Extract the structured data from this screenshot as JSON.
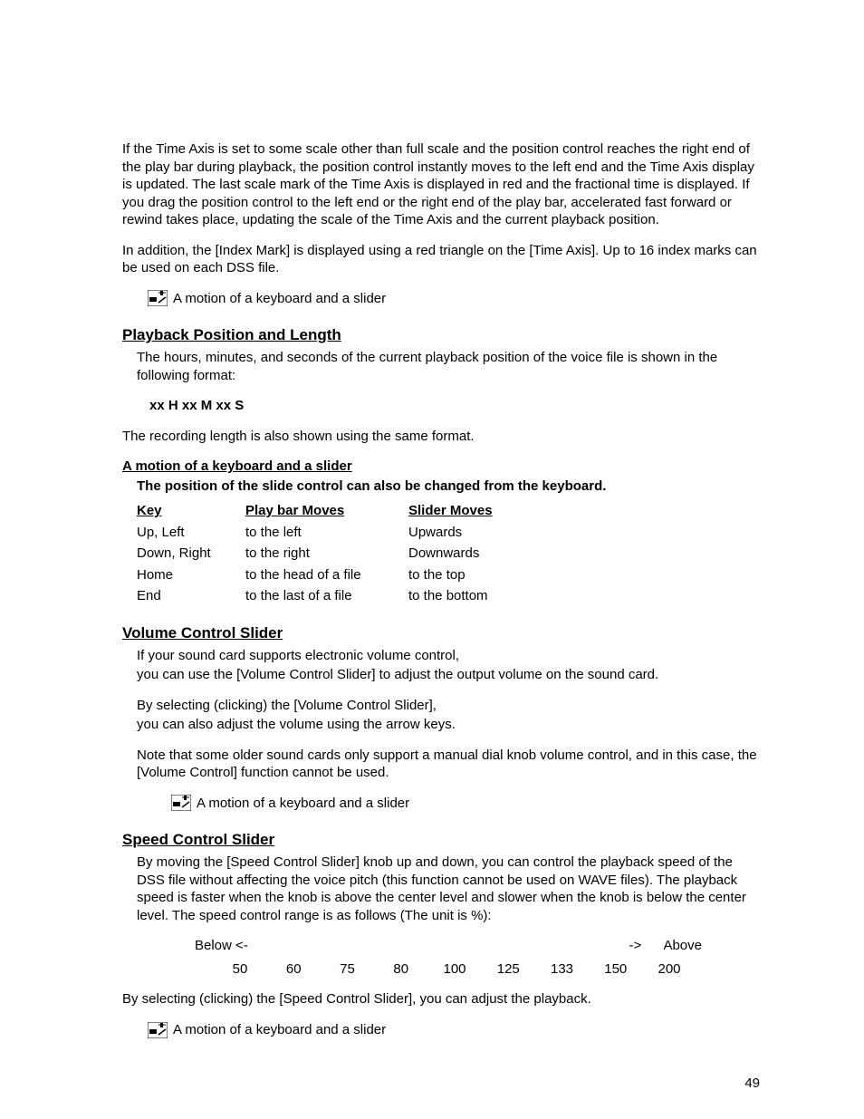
{
  "intro": {
    "p1": "If the Time Axis is set to some scale other than full scale and the position control reaches the right end of the play bar during playback, the position control instantly moves to the left end and the Time Axis display is updated.  The last scale mark of the Time Axis is displayed in red and the fractional time is displayed.  If you drag the position control to the left end or the right end of the play bar, accelerated fast forward or rewind takes place, updating the scale of the Time Axis and the current playback position.",
    "p2": "In addition, the [Index Mark] is displayed using a red triangle on the [Time Axis].  Up to 16 index marks can be used on each DSS file."
  },
  "motion_label": "A motion of a keyboard and a slider",
  "sections": {
    "playback": {
      "heading": "Playback Position and Length",
      "p1": "The hours, minutes, and seconds of the current playback position of the voice file is shown in the following format:",
      "format": "xx H xx M xx S",
      "p2": "The recording length is also shown using the same format.",
      "sub_heading": "A motion of a keyboard and a slider",
      "sub_line": "The position of the slide control can also be changed from the keyboard.",
      "table": {
        "headers": [
          "Key",
          "Play bar Moves",
          "Slider Moves"
        ],
        "rows": [
          [
            "Up, Left",
            "to the left",
            "Upwards"
          ],
          [
            "Down, Right",
            "to the right",
            "Downwards"
          ],
          [
            "Home",
            "to the head of a file",
            "to the top"
          ],
          [
            "End",
            "to the last of a file",
            "to the bottom"
          ]
        ]
      }
    },
    "volume": {
      "heading": "Volume Control Slider",
      "p1": "If your sound card supports electronic volume control,",
      "p2": "you can use the [Volume Control Slider] to adjust the output volume on the sound card.",
      "p3": "By selecting (clicking) the [Volume Control Slider],",
      "p4": "you can also adjust the volume using the arrow keys.",
      "p5": "Note that some older sound cards only support a manual dial knob volume control, and in this case, the [Volume Control] function cannot be used."
    },
    "speed": {
      "heading": "Speed Control Slider",
      "p1": "By moving the [Speed Control Slider] knob up and down, you can control the playback speed of the DSS file without affecting the voice pitch (this function cannot be used on WAVE files).  The playback speed is faster when the knob is above the center level and slower when the knob is below the center level. The speed control range is as follows (The unit is %):",
      "range_labels": {
        "left": "Below <-",
        "right": "->      Above"
      },
      "range_values": [
        "50",
        "60",
        "75",
        "80",
        "100",
        "125",
        "133",
        "150",
        "200"
      ],
      "p2": "By selecting (clicking) the [Speed Control Slider], you can adjust the playback."
    }
  },
  "page_number": "49"
}
